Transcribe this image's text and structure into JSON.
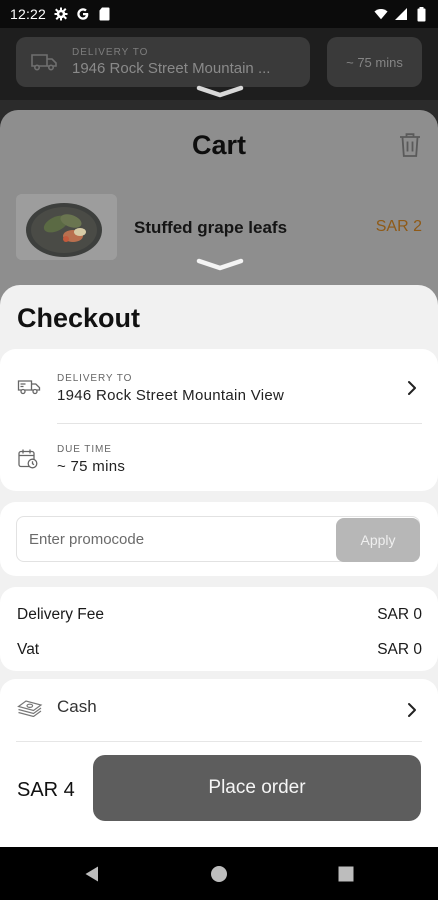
{
  "status_bar": {
    "time": "12:22",
    "icons": [
      "settings-icon",
      "google-icon",
      "sim-card-icon",
      "wifi-icon",
      "signal-icon",
      "battery-icon"
    ]
  },
  "header": {
    "delivery_label": "DELIVERY TO",
    "delivery_address": "1946 Rock Street Mountain ...",
    "time_estimate": "~ 75 mins"
  },
  "cart": {
    "title": "Cart",
    "items": [
      {
        "name": "Stuffed grape leafs",
        "price": "SAR 2"
      }
    ]
  },
  "checkout": {
    "title": "Checkout",
    "delivery": {
      "label": "DELIVERY TO",
      "value": "1946 Rock Street Mountain View"
    },
    "due_time": {
      "label": "DUE TIME",
      "value": "~ 75 mins"
    },
    "promo": {
      "placeholder": "Enter promocode",
      "apply_label": "Apply"
    },
    "fees": [
      {
        "label": "Delivery Fee",
        "value": "SAR 0"
      },
      {
        "label": "Vat",
        "value": "SAR 0"
      }
    ],
    "payment": {
      "method": "Cash"
    },
    "total": "SAR 4",
    "place_order_label": "Place order"
  },
  "colors": {
    "price_accent": "#8f5a17",
    "place_order_bg": "#5d5d5d",
    "apply_bg": "#b7b7b7"
  }
}
